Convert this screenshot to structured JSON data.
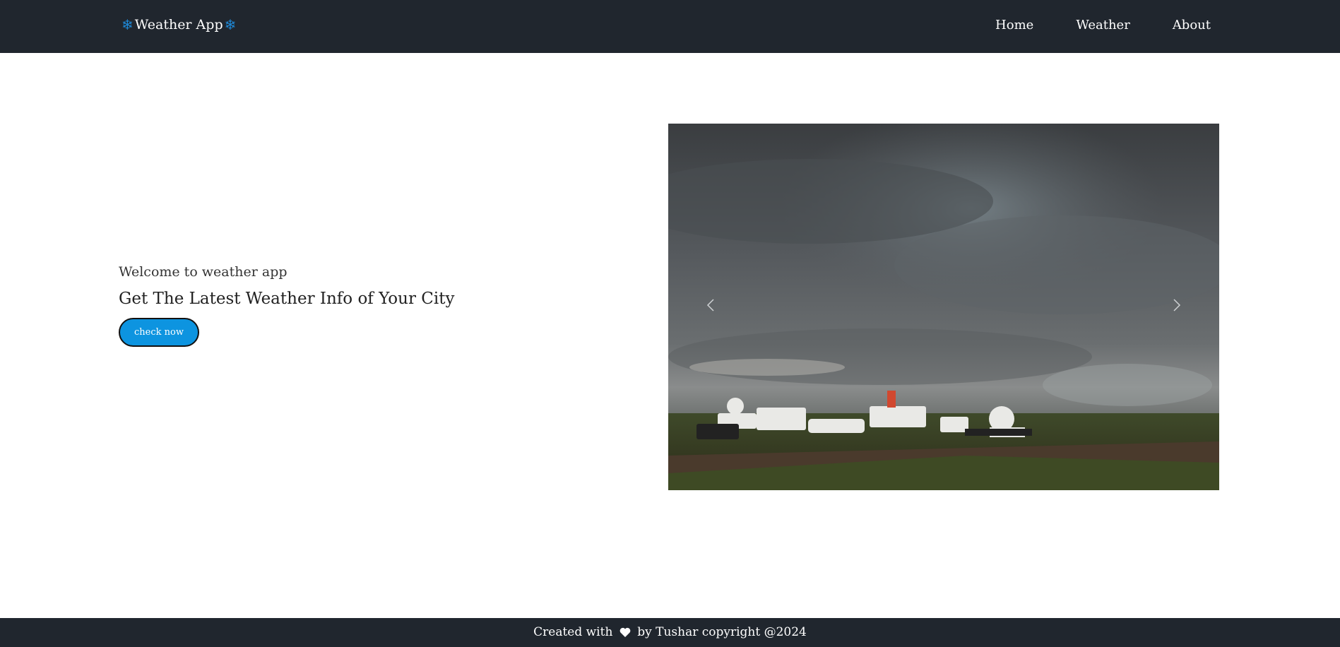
{
  "nav": {
    "brand": "Weather App",
    "brand_icon": "snowflake-icon",
    "brand_icon_color": "#1e88d6",
    "links": [
      "Home",
      "Weather",
      "About"
    ]
  },
  "hero": {
    "subtitle": "Welcome to weather app",
    "headline": "Get The Latest Weather Info of Your City",
    "button": "check now",
    "button_color": "#0d94e0"
  },
  "carousel": {
    "image": "storm-clouds-over-vehicles-photo",
    "prev_icon": "chevron-left-icon",
    "next_icon": "chevron-right-icon"
  },
  "footer": {
    "before": "Created with",
    "heart_icon": "heart-icon",
    "after": "by Tushar copyright @2024"
  },
  "colors": {
    "navbar_bg": "#20262e",
    "footer_bg": "#20262e"
  }
}
